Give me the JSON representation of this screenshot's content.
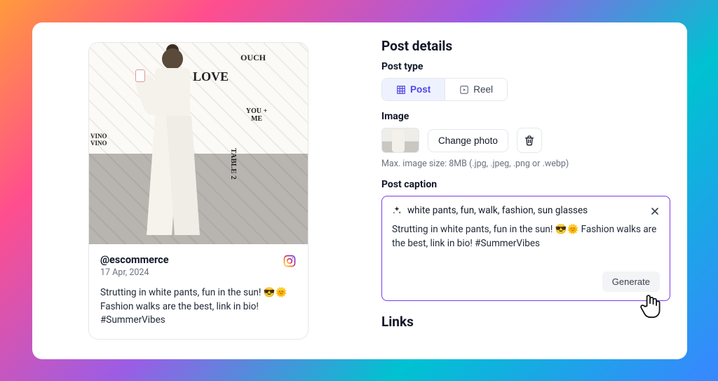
{
  "preview": {
    "handle": "@escommerce",
    "date": "17 Apr, 2024",
    "caption": "Strutting in white pants, fun in the sun! 😎🌞 Fashion walks are the best, link in bio! #SummerVibes",
    "platform_icon": "instagram-icon",
    "illustration_labels": [
      "LOVE",
      "OUCH",
      "YOU + ME",
      "TABLE 2",
      "VINO VINO"
    ]
  },
  "details": {
    "title": "Post details",
    "post_type": {
      "label": "Post type",
      "options": [
        {
          "key": "post",
          "label": "Post",
          "active": true,
          "icon": "grid-icon"
        },
        {
          "key": "reel",
          "label": "Reel",
          "active": false,
          "icon": "reel-icon"
        }
      ]
    },
    "image": {
      "label": "Image",
      "change_label": "Change photo",
      "delete_label": "Delete",
      "hint": "Max. image size: 8MB (.jpg, .jpeg, .png or .webp)"
    },
    "caption": {
      "label": "Post caption",
      "keywords": "white pants, fun, walk, fashion, sun glasses",
      "text": "Strutting in white pants, fun in the sun! 😎🌞 Fashion walks are the best, link in bio! #SummerVibes",
      "generate_label": "Generate"
    },
    "links_label": "Links"
  }
}
